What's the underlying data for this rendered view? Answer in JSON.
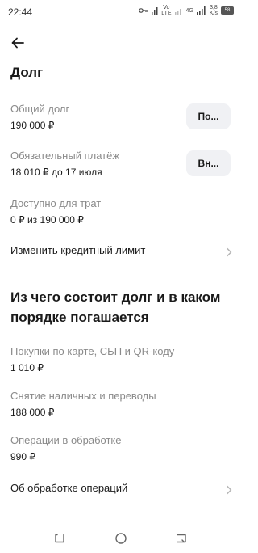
{
  "status_bar": {
    "time": "22:44",
    "network_label_1": "Vo\nLTE",
    "network_label_2": "4G",
    "speed_value": "3,8",
    "speed_unit": "K/s",
    "battery": "58"
  },
  "header": {
    "title": "Долг"
  },
  "rows": [
    {
      "label": "Общий долг",
      "value": "190 000 ₽",
      "button": "По..."
    },
    {
      "label": "Обязательный платёж",
      "value": "18 010 ₽ до 17 июля",
      "button": "Вн..."
    },
    {
      "label": "Доступно для трат",
      "value": "0 ₽ из 190 000 ₽"
    }
  ],
  "credit_limit_link": "Изменить кредитный лимит",
  "composition": {
    "title": "Из чего состоит долг и в каком порядке погашается",
    "items": [
      {
        "label": "Покупки по карте, СБП и QR-коду",
        "value": "1 010 ₽"
      },
      {
        "label": "Снятие наличных и переводы",
        "value": "188 000 ₽"
      },
      {
        "label": "Операции в обработке",
        "value": "990 ₽"
      }
    ]
  },
  "processing_link": "Об обработке операций",
  "icons": {
    "back": "arrow-left-icon",
    "chevron": "chevron-right-icon",
    "nav_back": "nav-back-icon",
    "nav_home": "nav-home-icon",
    "nav_recent": "nav-recent-icon"
  },
  "colors": {
    "label_gray": "#8a8a8a",
    "pill_bg": "#f0f1f4",
    "text": "#1a1a1a"
  }
}
